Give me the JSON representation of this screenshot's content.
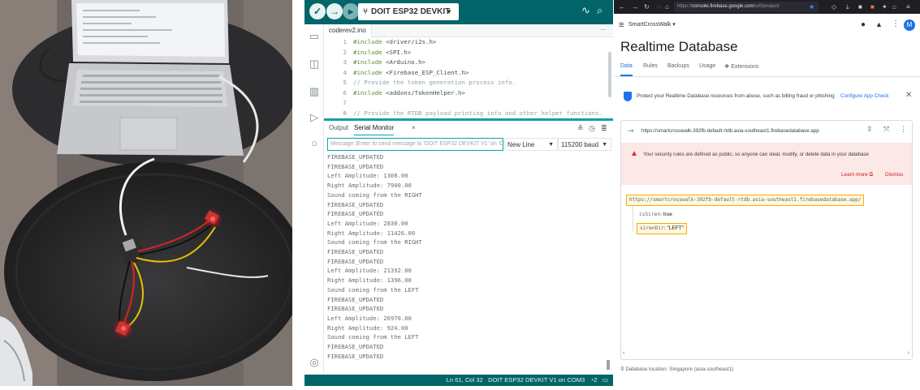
{
  "ide": {
    "board": "DOIT ESP32 DEVKIT V1",
    "file_tab": "coderev2.ino",
    "file_tab_more": "···",
    "code": [
      {
        "n": "1",
        "pre": "#include ",
        "arg": "<driver/i2s.h>"
      },
      {
        "n": "2",
        "pre": "#include ",
        "arg": "<SPI.h>"
      },
      {
        "n": "3",
        "pre": "#include ",
        "arg": "<Arduino.h>"
      },
      {
        "n": "4",
        "pre": "#include ",
        "arg": "<Firebase_ESP_Client.h>"
      },
      {
        "n": "5",
        "comment": "// Provide the token generation process info."
      },
      {
        "n": "6",
        "pre": "#include ",
        "arg": "<addons/TokenHelper.h>"
      },
      {
        "n": "7",
        "comment": ""
      },
      {
        "n": "8",
        "comment": "// Provide the RTDB payload printing info and other helper functions."
      }
    ],
    "panel_tabs": {
      "output": "Output",
      "serial_monitor": "Serial Monitor",
      "close": "×"
    },
    "message_placeholder": "Message (Enter to send message to 'DOIT ESP32 DEVKIT V1' on 'C",
    "line_ending": "New Line",
    "baud": "115200 baud",
    "serial_lines": [
      "FIREBASE_UPDATED",
      "FIREBASE_UPDATED",
      "Left Amplitude: 1308.00",
      "Right Amplitude: 7900.00",
      "Sound coming from the RIGHT",
      "FIREBASE_UPDATED",
      "FIREBASE_UPDATED",
      "Left Amplitude: 2830.00",
      "Right Amplitude: 11426.00",
      "Sound coming from the RIGHT",
      "FIREBASE_UPDATED",
      "FIREBASE_UPDATED",
      "Left Amplitude: 21392.00",
      "Right Amplitude: 1396.00",
      "Sound coming from the LEFT",
      "FIREBASE_UPDATED",
      "FIREBASE_UPDATED",
      "Left Amplitude: 26970.00",
      "Right Amplitude: 924.00",
      "Sound coming from the LEFT",
      "FIREBASE_UPDATED",
      "FIREBASE_UPDATED"
    ],
    "status": {
      "position": "Ln 61, Col 32",
      "board_port": "DOIT ESP32 DEVKIT V1 on COM3",
      "notifications": "2"
    },
    "colors": {
      "brand": "#006468",
      "accent": "#0ca1a6"
    }
  },
  "firebase": {
    "url_prefix": "https://",
    "url_host": "console.firebase.google.com",
    "url_rest": "/u/0/project/",
    "project": "SmartCrossWalk",
    "avatar": "M",
    "title": "Realtime Database",
    "tabs": [
      "Data",
      "Rules",
      "Backups",
      "Usage",
      "Extensions"
    ],
    "appcheck": {
      "text": "Protect your Realtime Database resources from abuse, such as billing fraud or phishing",
      "link": "Configure App Check"
    },
    "db_url": "https://smartcrosswalk-392fb-default-rtdb.asia-southeast1.firebasedatabase.app",
    "warning": {
      "text": "Your security rules are defined as public, so anyone can steal, modify, or delete data in your database",
      "learn_more": "Learn more",
      "dismiss": "Dismiss"
    },
    "root": "https://smartcrosswalk-392fb-default-rtdb.asia-southeast1.firebasedatabase.app/",
    "children": [
      {
        "key": "isSiren",
        "value": "true"
      },
      {
        "key": "sirenDir",
        "value": "\"LEFT\""
      }
    ],
    "location": "Database location: Singapore (asia-southeast1)",
    "colors": {
      "primary": "#1a73e8",
      "warning_bg": "#fce8e6",
      "highlight": "#f9ab00"
    }
  }
}
